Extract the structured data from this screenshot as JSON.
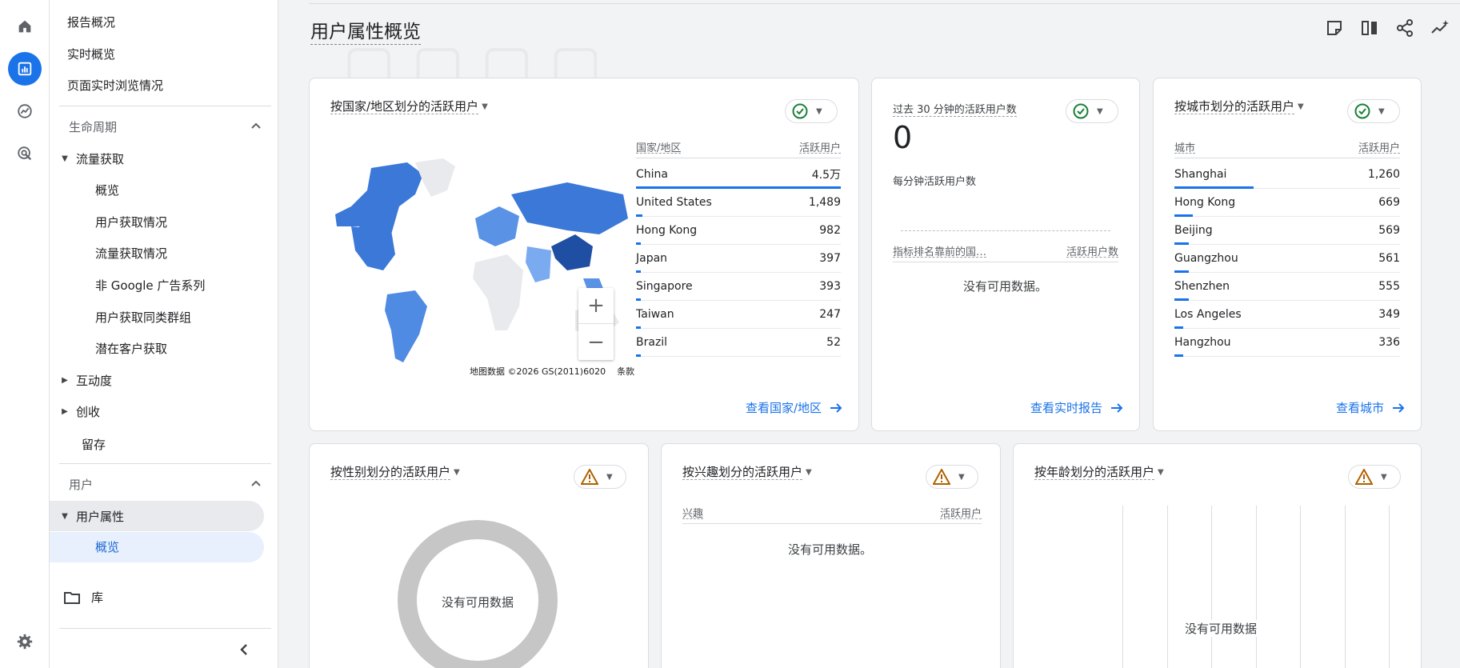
{
  "rail": {
    "items": [
      {
        "icon": "home-icon"
      },
      {
        "icon": "reports-icon"
      },
      {
        "icon": "explore-icon"
      },
      {
        "icon": "advertising-icon"
      }
    ],
    "settings_icon": "gear-icon"
  },
  "sidebar": {
    "top_links": [
      "报告概况",
      "实时概览",
      "页面实时浏览情况"
    ],
    "section_lifecycle": "生命周期",
    "group_acquisition": "流量获取",
    "acquisition_items": [
      "概览",
      "用户获取情况",
      "流量获取情况",
      "非 Google 广告系列",
      "用户获取同类群组",
      "潜在客户获取"
    ],
    "group_engagement": "互动度",
    "group_monetization": "创收",
    "retention": "留存",
    "section_user": "用户",
    "group_user_attributes": "用户属性",
    "user_attr_overview": "概览",
    "library": "库"
  },
  "page": {
    "title": "用户属性概览"
  },
  "cards": {
    "country": {
      "title": "按国家/地区划分的活跃用户",
      "col1": "国家/地区",
      "col2": "活跃用户",
      "rows": [
        {
          "name": "China",
          "value": "4.5万",
          "bar": 1.0
        },
        {
          "name": "United States",
          "value": "1,489",
          "bar": 0.033
        },
        {
          "name": "Hong Kong",
          "value": "982",
          "bar": 0.022
        },
        {
          "name": "Japan",
          "value": "397",
          "bar": 0.009
        },
        {
          "name": "Singapore",
          "value": "393",
          "bar": 0.009
        },
        {
          "name": "Taiwan",
          "value": "247",
          "bar": 0.006
        },
        {
          "name": "Brazil",
          "value": "52",
          "bar": 0.002
        }
      ],
      "map_attribution": "地图数据 ©2026 GS(2011)6020",
      "map_terms": "条款",
      "link": "查看国家/地区"
    },
    "realtime": {
      "title": "过去 30 分钟的活跃用户数",
      "count": "0",
      "subtitle": "每分钟活跃用户数",
      "col1": "指标排名靠前的国…",
      "col2": "活跃用户数",
      "nodata": "没有可用数据。",
      "link": "查看实时报告"
    },
    "city": {
      "title": "按城市划分的活跃用户",
      "col1": "城市",
      "col2": "活跃用户",
      "rows": [
        {
          "name": "Shanghai",
          "value": "1,260",
          "bar": 0.35
        },
        {
          "name": "Hong Kong",
          "value": "669",
          "bar": 0.08
        },
        {
          "name": "Beijing",
          "value": "569",
          "bar": 0.065
        },
        {
          "name": "Guangzhou",
          "value": "561",
          "bar": 0.065
        },
        {
          "name": "Shenzhen",
          "value": "555",
          "bar": 0.065
        },
        {
          "name": "Los Angeles",
          "value": "349",
          "bar": 0.04
        },
        {
          "name": "Hangzhou",
          "value": "336",
          "bar": 0.04
        }
      ],
      "link": "查看城市"
    },
    "gender": {
      "title": "按性别划分的活跃用户",
      "nodata": "没有可用数据"
    },
    "interest": {
      "title": "按兴趣划分的活跃用户",
      "col1": "兴趣",
      "col2": "活跃用户",
      "nodata": "没有可用数据。"
    },
    "age": {
      "title": "按年龄划分的活跃用户",
      "nodata": "没有可用数据"
    }
  },
  "colors": {
    "accent": "#1a73e8",
    "ok": "#188038",
    "warn": "#e37400"
  }
}
